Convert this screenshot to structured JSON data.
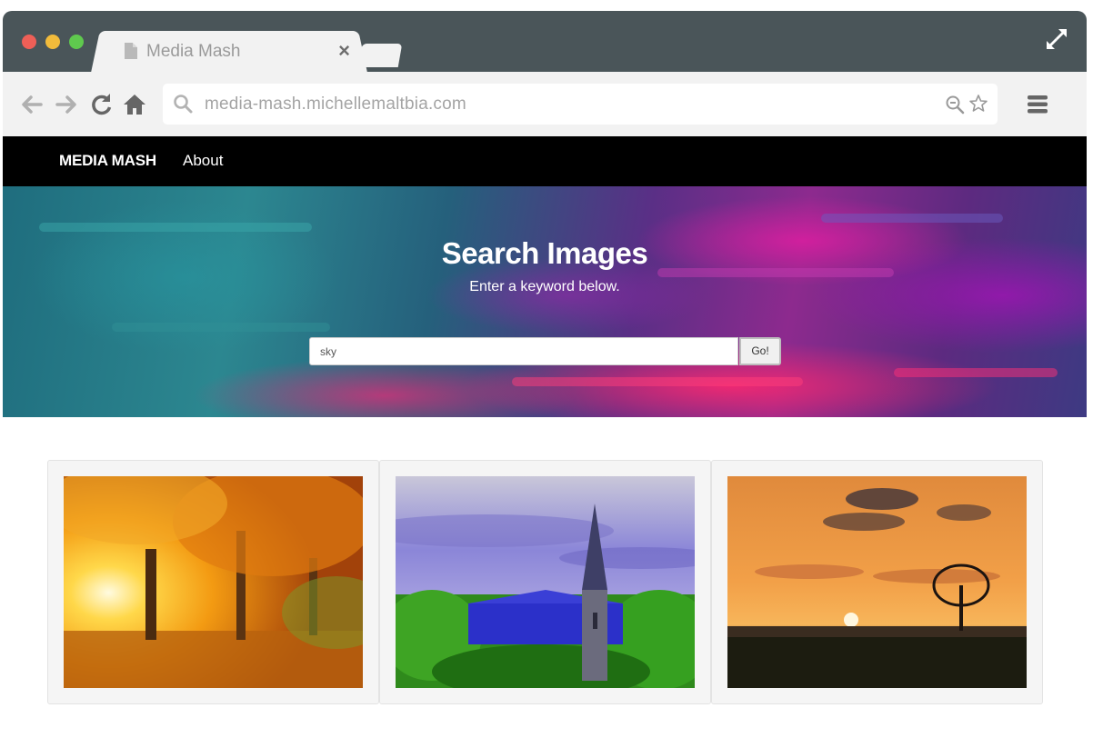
{
  "browser": {
    "tab_title": "Media Mash",
    "close_glyph": "×",
    "url": "media-mash.michellemaltbia.com",
    "icons": [
      "back-arrow-icon",
      "forward-arrow-icon",
      "reload-icon",
      "home-icon",
      "search-icon",
      "zoom-out-icon",
      "star-icon",
      "menu-icon",
      "expand-icon",
      "document-icon"
    ]
  },
  "site_nav": {
    "brand": "MEDIA MASH",
    "about": "About"
  },
  "hero": {
    "title": "Search Images",
    "subtitle": "Enter a keyword below.",
    "search_value": "sky",
    "go_label": "Go!"
  },
  "results": [
    {
      "description": "autumn-forest-sunlight-photo"
    },
    {
      "description": "church-steeple-photo"
    },
    {
      "description": "sunset-tree-field-photo"
    }
  ],
  "colors": {
    "chrome_dark": "#4a5559",
    "chrome_light": "#f2f2f2",
    "nav_bg": "#000000",
    "accent_pink": "#e0287a",
    "accent_teal": "#2c8790"
  }
}
